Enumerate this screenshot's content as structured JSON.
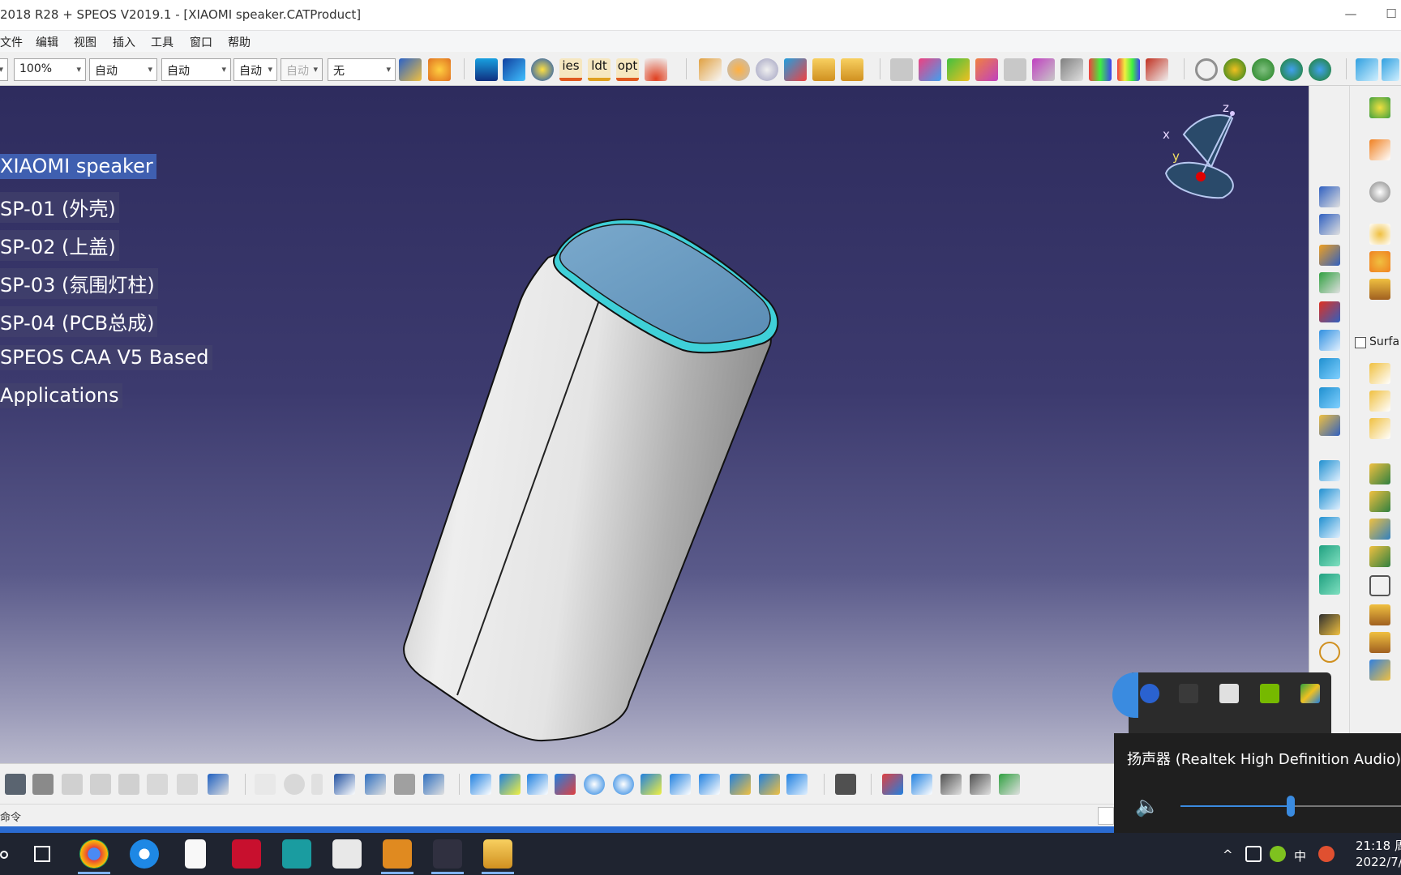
{
  "window": {
    "title": "2018 R28 + SPEOS V2019.1 - [XIAOMI speaker.CATProduct]",
    "minimize_glyph": "—",
    "maximize_glyph": "☐"
  },
  "menu": {
    "items": [
      "文件",
      "编辑",
      "视图",
      "插入",
      "工具",
      "窗口",
      "帮助"
    ]
  },
  "toolbar": {
    "zoom_value": "100%",
    "combo1_value": "自动",
    "combo2_value": "自动",
    "combo3_value": "自动",
    "combo4_value": "自动",
    "combo5_value": "无",
    "icon_labels": [
      "ies",
      "ldt",
      "opt"
    ]
  },
  "tree": {
    "items": [
      "XIAOMI speaker",
      "SP-01 (外壳)",
      "SP-02 (上盖)",
      "SP-03 (氛围灯柱)",
      "SP-04 (PCB总成)",
      "SPEOS CAA V5 Based",
      "Applications"
    ],
    "selected_index": 0
  },
  "compass": {
    "x": "x",
    "y": "y",
    "z": "z"
  },
  "right_toolbar": {
    "surface_label": "Surfa"
  },
  "status": {
    "command_label": "命令"
  },
  "volume_popup": {
    "device": "扬声器 (Realtek High Definition Audio)",
    "level": 0.5
  },
  "taskbar": {
    "clock_time": "21:18 周",
    "clock_date": "2022/7/",
    "ime": "中",
    "tray_chevron": "^"
  },
  "colors": {
    "viewport_top": "#2e2c5e",
    "viewport_bottom": "#b8b8cc",
    "speaker_top": "#6a9bc0",
    "speaker_rim": "#3fd0d8",
    "selection": "#3f5fb0",
    "accent_blue": "#3a8be0"
  }
}
